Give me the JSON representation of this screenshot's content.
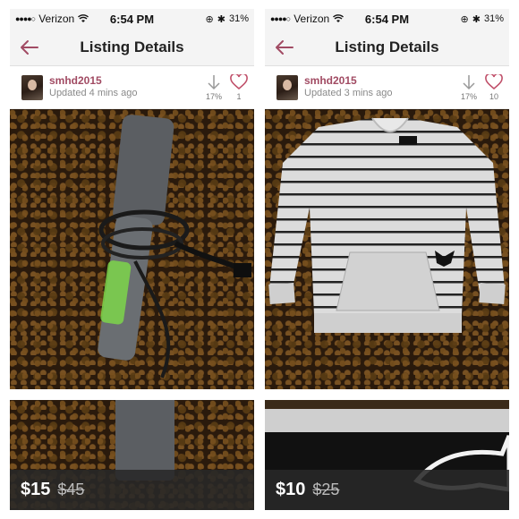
{
  "panels": [
    {
      "status": {
        "carrier": "Verizon",
        "time": "6:54 PM",
        "battery": "31%"
      },
      "nav": {
        "title": "Listing Details"
      },
      "seller": {
        "name": "smhd2015",
        "updated": "Updated 4 mins ago"
      },
      "stats": {
        "discount": "17%",
        "likes": "1"
      },
      "price": {
        "current": "$15",
        "original": "$45"
      },
      "photo_icon": "hair-straightener-photo"
    },
    {
      "status": {
        "carrier": "Verizon",
        "time": "6:54 PM",
        "battery": "31%"
      },
      "nav": {
        "title": "Listing Details"
      },
      "seller": {
        "name": "smhd2015",
        "updated": "Updated 3 mins ago"
      },
      "stats": {
        "discount": "17%",
        "likes": "10"
      },
      "price": {
        "current": "$10",
        "original": "$25"
      },
      "photo_icon": "striped-sweatshirt-photo"
    }
  ],
  "colors": {
    "accent": "#a14b63",
    "heart": "#c0506a",
    "price_bar": "#282828"
  }
}
